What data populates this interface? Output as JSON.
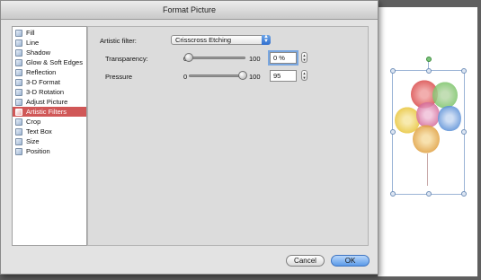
{
  "dialog": {
    "title": "Format Picture"
  },
  "categories": [
    {
      "label": "Fill",
      "icon": "fill-bucket-icon",
      "selected": false
    },
    {
      "label": "Line",
      "icon": "line-icon",
      "selected": false
    },
    {
      "label": "Shadow",
      "icon": "shadow-icon",
      "selected": false
    },
    {
      "label": "Glow & Soft Edges",
      "icon": "glow-icon",
      "selected": false
    },
    {
      "label": "Reflection",
      "icon": "reflection-icon",
      "selected": false
    },
    {
      "label": "3-D Format",
      "icon": "3d-format-icon",
      "selected": false
    },
    {
      "label": "3-D Rotation",
      "icon": "3d-rotation-icon",
      "selected": false
    },
    {
      "label": "Adjust Picture",
      "icon": "adjust-picture-icon",
      "selected": false
    },
    {
      "label": "Artistic Filters",
      "icon": "artistic-filters-icon",
      "selected": true
    },
    {
      "label": "Crop",
      "icon": "crop-icon",
      "selected": false
    },
    {
      "label": "Text Box",
      "icon": "text-box-icon",
      "selected": false
    },
    {
      "label": "Size",
      "icon": "size-icon",
      "selected": false
    },
    {
      "label": "Position",
      "icon": "position-icon",
      "selected": false
    }
  ],
  "panel": {
    "filter_label": "Artistic filter:",
    "filter_value": "Crisscross Etching",
    "transparency": {
      "label": "Transparency:",
      "min_label": "0",
      "max_label": "100",
      "field_value": "0 %",
      "level": 0.0
    },
    "pressure": {
      "label": "Pressure",
      "min_label": "0",
      "max_label": "100",
      "field_value": "95",
      "level": 0.95
    }
  },
  "buttons": {
    "cancel": "Cancel",
    "ok": "OK"
  },
  "colors": {
    "selection_highlight": "#d05757",
    "default_button": "#5b9ae8",
    "balloon_red": "#d94b4b",
    "balloon_yellow": "#e8c53a",
    "balloon_blue": "#5a8fd6",
    "balloon_green": "#7cc46a",
    "balloon_purple": "#b07ad0"
  }
}
